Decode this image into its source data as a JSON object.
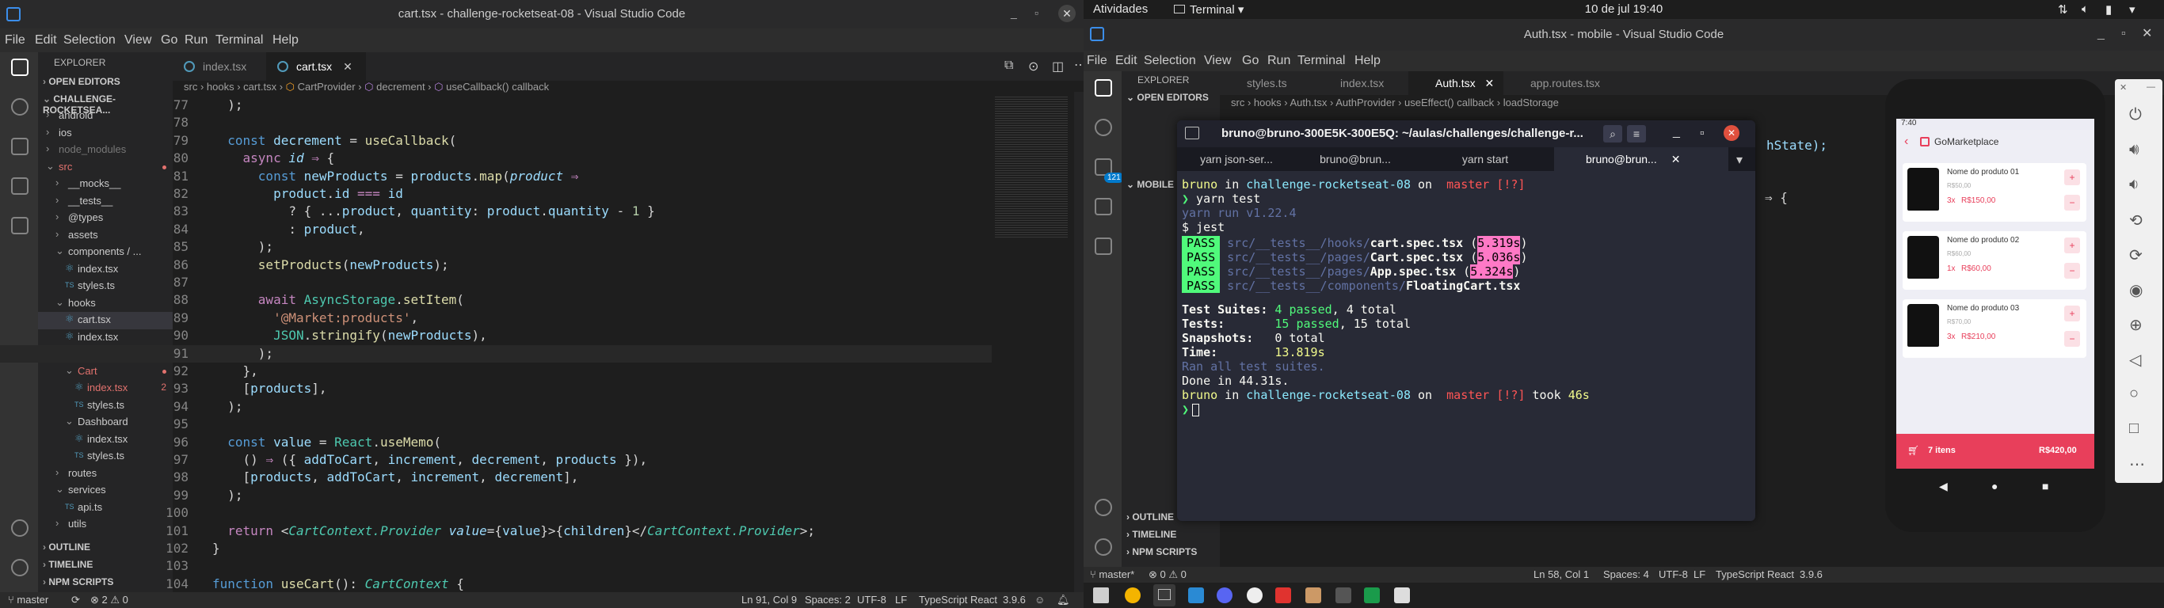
{
  "left": {
    "window_title": "cart.tsx - challenge-rocketseat-08 - Visual Studio Code",
    "menu": [
      "File",
      "Edit",
      "Selection",
      "View",
      "Go",
      "Run",
      "Terminal",
      "Help"
    ],
    "explorer_label": "EXPLORER",
    "open_editors": "OPEN EDITORS",
    "project": "CHALLENGE-ROCKETSEA...",
    "tree": [
      {
        "label": "android",
        "indent": 1,
        "kind": "folder-c"
      },
      {
        "label": "ios",
        "indent": 1,
        "kind": "folder-c"
      },
      {
        "label": "node_modules",
        "indent": 1,
        "kind": "folder-c",
        "dim": true
      },
      {
        "label": "src",
        "indent": 1,
        "kind": "folder-o",
        "dot": true,
        "red": true
      },
      {
        "label": "__mocks__",
        "indent": 2,
        "kind": "folder-c"
      },
      {
        "label": "__tests__",
        "indent": 2,
        "kind": "folder-c"
      },
      {
        "label": "@types",
        "indent": 2,
        "kind": "folder-c"
      },
      {
        "label": "assets",
        "indent": 2,
        "kind": "folder-c"
      },
      {
        "label": "components / ...",
        "indent": 2,
        "kind": "folder-o"
      },
      {
        "label": "index.tsx",
        "indent": 3,
        "kind": "tsx"
      },
      {
        "label": "styles.ts",
        "indent": 3,
        "kind": "ts"
      },
      {
        "label": "hooks",
        "indent": 2,
        "kind": "folder-o"
      },
      {
        "label": "cart.tsx",
        "indent": 3,
        "kind": "tsx",
        "selected": true
      },
      {
        "label": "index.tsx",
        "indent": 3,
        "kind": "tsx"
      },
      {
        "label": "pages",
        "indent": 2,
        "kind": "folder-o",
        "dot": true,
        "red": true
      },
      {
        "label": "Cart",
        "indent": 3,
        "kind": "folder-o",
        "dot": true,
        "red": true
      },
      {
        "label": "index.tsx",
        "indent": 4,
        "kind": "tsx",
        "badge": "2",
        "red": true
      },
      {
        "label": "styles.ts",
        "indent": 4,
        "kind": "ts"
      },
      {
        "label": "Dashboard",
        "indent": 3,
        "kind": "folder-o"
      },
      {
        "label": "index.tsx",
        "indent": 4,
        "kind": "tsx"
      },
      {
        "label": "styles.ts",
        "indent": 4,
        "kind": "ts"
      },
      {
        "label": "routes",
        "indent": 2,
        "kind": "folder-c"
      },
      {
        "label": "services",
        "indent": 2,
        "kind": "folder-o"
      },
      {
        "label": "api.ts",
        "indent": 3,
        "kind": "ts"
      },
      {
        "label": "utils",
        "indent": 2,
        "kind": "folder-c"
      }
    ],
    "sections": [
      "OUTLINE",
      "TIMELINE",
      "NPM SCRIPTS"
    ],
    "tabs": [
      "index.tsx",
      "cart.tsx"
    ],
    "breadcrumb": [
      "src",
      "hooks",
      "cart.tsx",
      "CartProvider",
      "decrement",
      "useCallback() callback"
    ],
    "status": {
      "branch": "master",
      "problems": "2",
      "warnings": "0",
      "position": "Ln 91, Col 9",
      "spaces": "Spaces: 2",
      "encoding": "UTF-8",
      "eol": "LF",
      "language": "TypeScript React",
      "version": "3.9.6"
    },
    "line_numbers": [
      "77",
      "78",
      "79",
      "80",
      "81",
      "82",
      "83",
      "84",
      "85",
      "86",
      "87",
      "88",
      "89",
      "90",
      "91",
      "92",
      "93",
      "94",
      "95",
      "96",
      "97",
      "98",
      "99",
      "100",
      "101",
      "102",
      "103",
      "104"
    ]
  },
  "topbar": {
    "activities": "Atividades",
    "app": "Terminal",
    "clock": "10 de jul  19:40"
  },
  "right": {
    "window_title": "Auth.tsx - mobile - Visual Studio Code",
    "menu": [
      "File",
      "Edit",
      "Selection",
      "View",
      "Go",
      "Run",
      "Terminal",
      "Help"
    ],
    "explorer_label": "EXPLORER",
    "open_editors": "OPEN EDITORS",
    "mobile_label": "MOBILE",
    "tabs": [
      "styles.ts",
      "index.tsx",
      "Auth.tsx",
      "app.routes.tsx"
    ],
    "breadcrumb": [
      "src",
      "hooks",
      "Auth.tsx",
      "AuthProvider",
      "useEffect() callback",
      "loadStorage"
    ],
    "sections": [
      "OUTLINE",
      "TIMELINE",
      "NPM SCRIPTS"
    ],
    "badge": "121",
    "code_frag1": "hState);",
    "code_frag2": "⇒ {",
    "status": {
      "branch": "master*",
      "problems": "0",
      "warnings": "0",
      "position": "Ln 58, Col 1",
      "spaces": "Spaces: 4",
      "encoding": "UTF-8",
      "eol": "LF",
      "language": "TypeScript React",
      "version": "3.9.6"
    }
  },
  "terminal": {
    "title": "bruno@bruno-300E5K-300E5Q: ~/aulas/challenges/challenge-r...",
    "tabs": [
      "yarn json-ser...",
      "bruno@brun...",
      "yarn start",
      "bruno@brun..."
    ],
    "prompt_user": "bruno",
    "prompt_in": " in ",
    "prompt_dir": "challenge-rocketseat-08",
    "prompt_on": " on ",
    "prompt_branch": " master [!?]",
    "cmd": " yarn test",
    "yarn_run": "yarn run v1.22.4",
    "jest": "$ jest",
    "pass_label": "PASS",
    "passes": [
      {
        "dir": "src/__tests__/hooks/",
        "file": "cart.spec.tsx",
        "time": "5.319s"
      },
      {
        "dir": "src/__tests__/pages/",
        "file": "Cart.spec.tsx",
        "time": "5.036s"
      },
      {
        "dir": "src/__tests__/pages/",
        "file": "App.spec.tsx",
        "time": "5.324s"
      },
      {
        "dir": "src/__tests__/components/",
        "file": "FloatingCart.tsx",
        "time": ""
      }
    ],
    "suites_label": "Test Suites:",
    "suites_val": "4 passed",
    "suites_tot": ", 4 total",
    "tests_label": "Tests:",
    "tests_val": "15 passed",
    "tests_tot": ", 15 total",
    "snap_label": "Snapshots:",
    "snap_val": "0 total",
    "time_label": "Time:",
    "time_val": "13.819s",
    "ran": "Ran all test suites.",
    "done": "Done in 44.31s.",
    "took": " took ",
    "took_val": "46s"
  },
  "phone": {
    "status_time": "7:40",
    "title": "GoMarketplace",
    "products": [
      {
        "name": "Nome do produto 01",
        "old": "R$50,00",
        "qty": "3x",
        "price": "R$150,00"
      },
      {
        "name": "Nome do produto 02",
        "old": "R$60,00",
        "qty": "1x",
        "price": "R$60,00"
      },
      {
        "name": "Nome do produto 03",
        "old": "R$70,00",
        "qty": "3x",
        "price": "R$210,00"
      }
    ],
    "footer_items": "7 itens",
    "footer_total": "R$420,00"
  },
  "colors": {
    "accent": "#007acc",
    "phone_accent": "#e83f5b",
    "term_bg": "#282a36"
  }
}
